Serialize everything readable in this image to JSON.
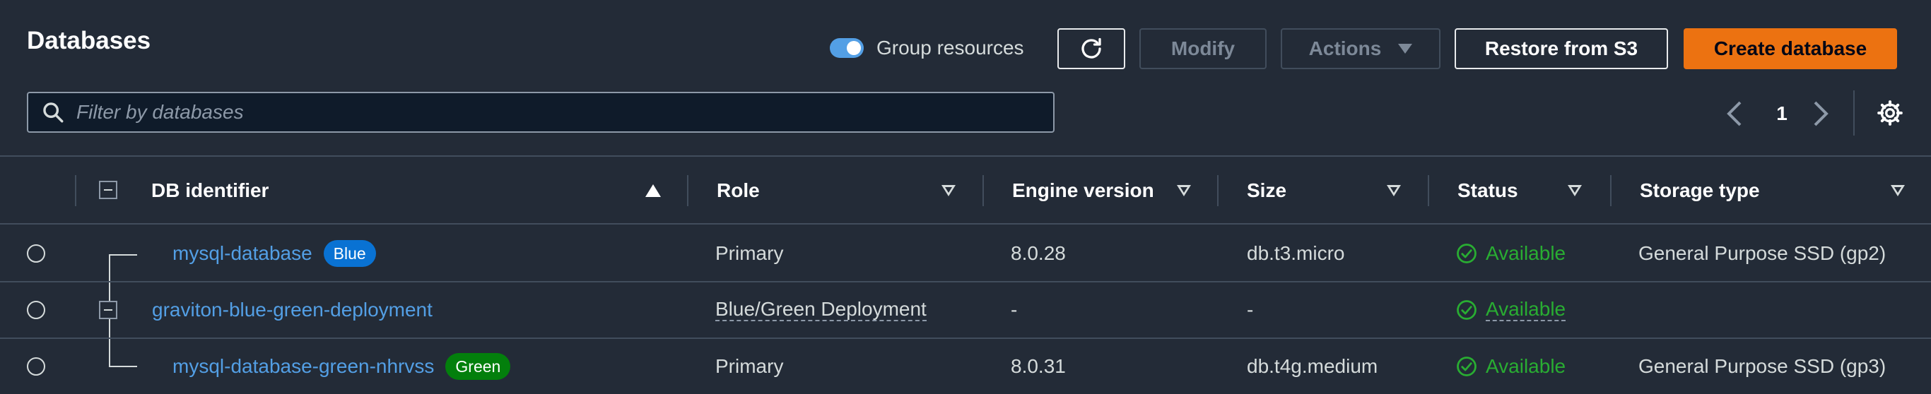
{
  "page": {
    "title": "Databases",
    "group_resources_label": "Group resources",
    "group_resources_on": true
  },
  "toolbar": {
    "modify_label": "Modify",
    "actions_label": "Actions",
    "restore_label": "Restore from S3",
    "create_label": "Create database"
  },
  "search": {
    "placeholder": "Filter by databases"
  },
  "pagination": {
    "current_page": "1"
  },
  "table": {
    "columns": [
      "DB identifier",
      "Role",
      "Engine version",
      "Size",
      "Status",
      "Storage type"
    ],
    "rows": [
      {
        "identifier": "mysql-database",
        "badge": "Blue",
        "role": "Primary",
        "engine_version": "8.0.28",
        "size": "db.t3.micro",
        "status": "Available",
        "storage_type": "General Purpose SSD (gp2)"
      },
      {
        "identifier": "graviton-blue-green-deployment",
        "badge": "",
        "role": "Blue/Green Deployment",
        "engine_version": "-",
        "size": "-",
        "status": "Available",
        "storage_type": ""
      },
      {
        "identifier": "mysql-database-green-nhrvss",
        "badge": "Green",
        "role": "Primary",
        "engine_version": "8.0.31",
        "size": "db.t4g.medium",
        "status": "Available",
        "storage_type": "General Purpose SSD (gp3)"
      }
    ]
  },
  "colors": {
    "background": "#232b37",
    "link": "#539fe5",
    "primary_button": "#ec7211",
    "badge_blue": "#0972d3",
    "badge_green": "#037f0c",
    "status_available": "#29ad32"
  }
}
